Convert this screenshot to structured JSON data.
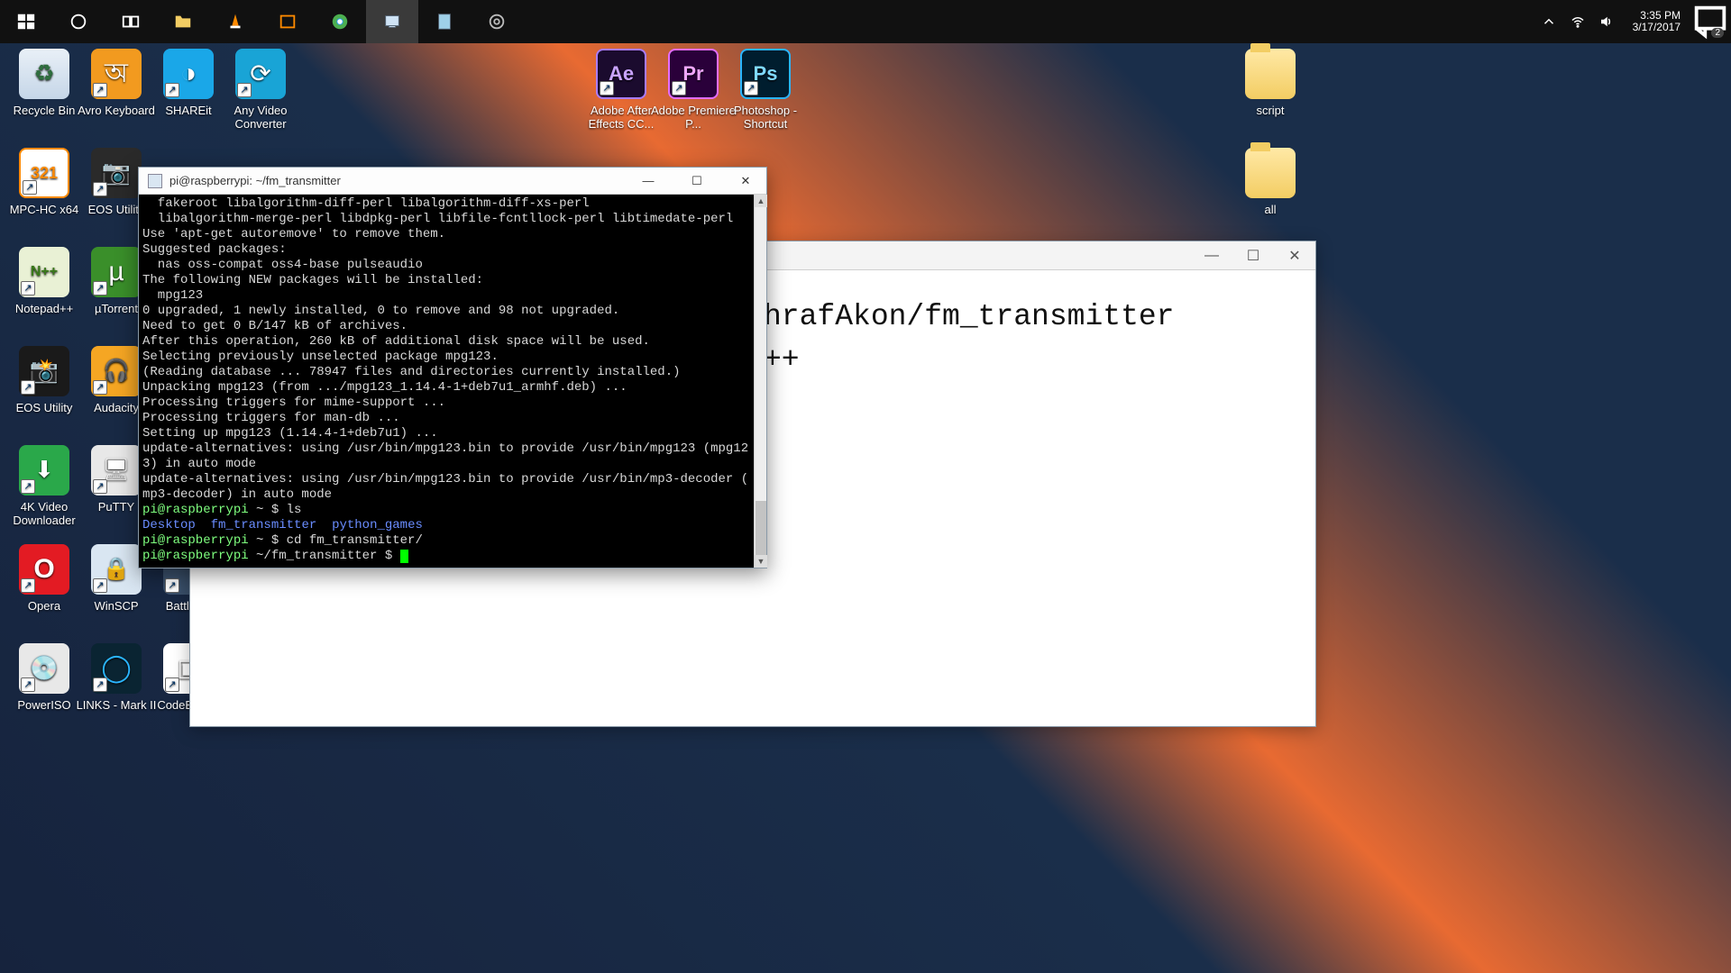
{
  "taskbar": {
    "time": "3:35 PM",
    "date": "3/17/2017",
    "notif_count": "2"
  },
  "desktop_icons": [
    {
      "id": "recycle",
      "label": "Recycle Bin",
      "glyph": "g-recycle",
      "col": 0,
      "row": 0,
      "shortcut": false
    },
    {
      "id": "avro",
      "label": "Avro Keyboard",
      "glyph": "g-avro",
      "col": 1,
      "row": 0,
      "shortcut": true
    },
    {
      "id": "shareit",
      "label": "SHAREit",
      "glyph": "g-share",
      "col": 2,
      "row": 0,
      "shortcut": true
    },
    {
      "id": "anyvid",
      "label": "Any Video Converter",
      "glyph": "g-anyv",
      "col": 3,
      "row": 0,
      "shortcut": true
    },
    {
      "id": "ae",
      "label": "Adobe After Effects CC...",
      "glyph": "g-ae",
      "col": 8,
      "row": 0,
      "shortcut": true
    },
    {
      "id": "pr",
      "label": "Adobe Premiere P...",
      "glyph": "g-pr",
      "col": 9,
      "row": 0,
      "shortcut": true
    },
    {
      "id": "ps",
      "label": "Photoshop - Shortcut",
      "glyph": "g-ps",
      "col": 10,
      "row": 0,
      "shortcut": true
    },
    {
      "id": "script",
      "label": "script",
      "glyph": "g-folder",
      "col": 17,
      "row": 0,
      "shortcut": false
    },
    {
      "id": "mpc",
      "label": "MPC-HC x64",
      "glyph": "g-mpc",
      "col": 0,
      "row": 1,
      "shortcut": true
    },
    {
      "id": "eosu",
      "label": "EOS Utility",
      "glyph": "g-eosu",
      "col": 1,
      "row": 1,
      "shortcut": true
    },
    {
      "id": "all",
      "label": "all",
      "glyph": "g-folder",
      "col": 17,
      "row": 1,
      "shortcut": false
    },
    {
      "id": "npp",
      "label": "Notepad++",
      "glyph": "g-npp",
      "col": 0,
      "row": 2,
      "shortcut": true
    },
    {
      "id": "ut",
      "label": "µTorrent",
      "glyph": "g-ut",
      "col": 1,
      "row": 2,
      "shortcut": true
    },
    {
      "id": "eos2",
      "label": "EOS Utility",
      "glyph": "g-eos2",
      "col": 0,
      "row": 3,
      "shortcut": true
    },
    {
      "id": "aud",
      "label": "Audacity",
      "glyph": "g-aud",
      "col": 1,
      "row": 3,
      "shortcut": true
    },
    {
      "id": "4k",
      "label": "4K Video Downloader",
      "glyph": "g-4k",
      "col": 0,
      "row": 4,
      "shortcut": true
    },
    {
      "id": "putty",
      "label": "PuTTY",
      "glyph": "g-putty",
      "col": 1,
      "row": 4,
      "shortcut": true
    },
    {
      "id": "opera",
      "label": "Opera",
      "glyph": "g-opera",
      "col": 0,
      "row": 5,
      "shortcut": true
    },
    {
      "id": "winscp",
      "label": "WinSCP",
      "glyph": "g-winscp",
      "col": 1,
      "row": 5,
      "shortcut": true
    },
    {
      "id": "bf",
      "label": "Battlefi...",
      "glyph": "g-bf",
      "col": 2,
      "row": 5,
      "shortcut": true
    },
    {
      "id": "piso",
      "label": "PowerISO",
      "glyph": "g-piso",
      "col": 0,
      "row": 6,
      "shortcut": true
    },
    {
      "id": "links",
      "label": "LINKS - Mark II",
      "glyph": "g-links",
      "col": 1,
      "row": 6,
      "shortcut": true
    },
    {
      "id": "cb",
      "label": "CodeBlocks",
      "glyph": "g-cb",
      "col": 2,
      "row": 6,
      "shortcut": true
    }
  ],
  "notepad": {
    "visible_line1": "hrafAkon/fm_transmitter",
    "visible_line2": "++"
  },
  "terminal": {
    "title": "pi@raspberrypi: ~/fm_transmitter",
    "lines": [
      {
        "t": "  fakeroot libalgorithm-diff-perl libalgorithm-diff-xs-perl"
      },
      {
        "t": "  libalgorithm-merge-perl libdpkg-perl libfile-fcntllock-perl libtimedate-perl"
      },
      {
        "t": "Use 'apt-get autoremove' to remove them."
      },
      {
        "t": "Suggested packages:"
      },
      {
        "t": "  nas oss-compat oss4-base pulseaudio"
      },
      {
        "t": "The following NEW packages will be installed:"
      },
      {
        "t": "  mpg123"
      },
      {
        "t": "0 upgraded, 1 newly installed, 0 to remove and 98 not upgraded."
      },
      {
        "t": "Need to get 0 B/147 kB of archives."
      },
      {
        "t": "After this operation, 260 kB of additional disk space will be used."
      },
      {
        "t": "Selecting previously unselected package mpg123."
      },
      {
        "t": "(Reading database ... 78947 files and directories currently installed.)"
      },
      {
        "t": "Unpacking mpg123 (from .../mpg123_1.14.4-1+deb7u1_armhf.deb) ..."
      },
      {
        "t": "Processing triggers for mime-support ..."
      },
      {
        "t": "Processing triggers for man-db ..."
      },
      {
        "t": "Setting up mpg123 (1.14.4-1+deb7u1) ..."
      },
      {
        "t": "update-alternatives: using /usr/bin/mpg123.bin to provide /usr/bin/mpg123 (mpg12"
      },
      {
        "t": "3) in auto mode"
      },
      {
        "t": "update-alternatives: using /usr/bin/mpg123.bin to provide /usr/bin/mp3-decoder ("
      },
      {
        "t": "mp3-decoder) in auto mode"
      }
    ],
    "prompt1_user": "pi@raspberrypi",
    "prompt1_path": "~",
    "prompt1_cmd": "ls",
    "ls_out": [
      "Desktop",
      "fm_transmitter",
      "python_games"
    ],
    "prompt2_user": "pi@raspberrypi",
    "prompt2_path": "~",
    "prompt2_cmd": "cd fm_transmitter/",
    "prompt3_user": "pi@raspberrypi",
    "prompt3_path": "~/fm_transmitter"
  }
}
